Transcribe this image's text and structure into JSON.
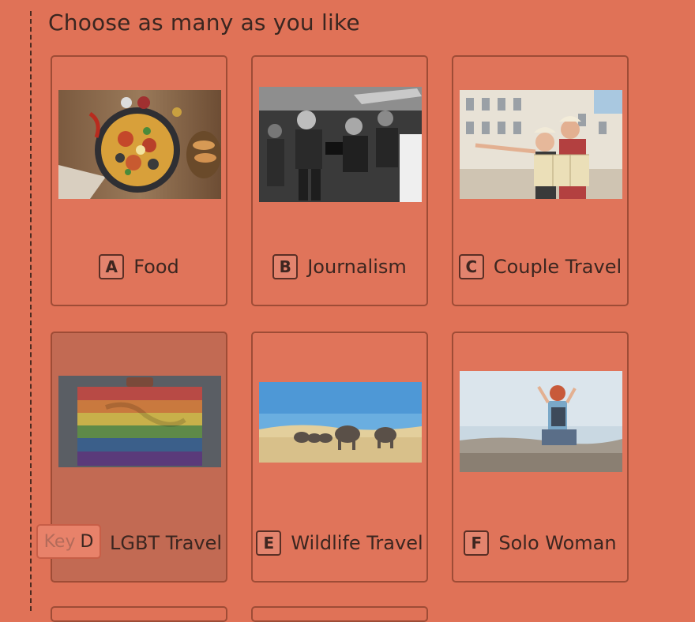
{
  "question": {
    "text": "Choose as many as you like"
  },
  "choices": [
    {
      "key": "A",
      "label": "Food",
      "image": "paella-pan-photo"
    },
    {
      "key": "B",
      "label": "Journalism",
      "image": "protest-black-white-photo"
    },
    {
      "key": "C",
      "label": "Couple Travel",
      "image": "couple-with-map-photo"
    },
    {
      "key": "D",
      "label": "LGBT Travel",
      "image": "rainbow-suitcase-photo"
    },
    {
      "key": "E",
      "label": "Wildlife Travel",
      "image": "elephants-savanna-photo"
    },
    {
      "key": "F",
      "label": "Solo Woman",
      "image": "woman-overlooking-city-photo"
    }
  ],
  "key_hint": {
    "label": "Key",
    "letter": "D"
  },
  "colors": {
    "background": "#e07257",
    "border": "#9e4c36",
    "hovered": "#c26a53"
  }
}
